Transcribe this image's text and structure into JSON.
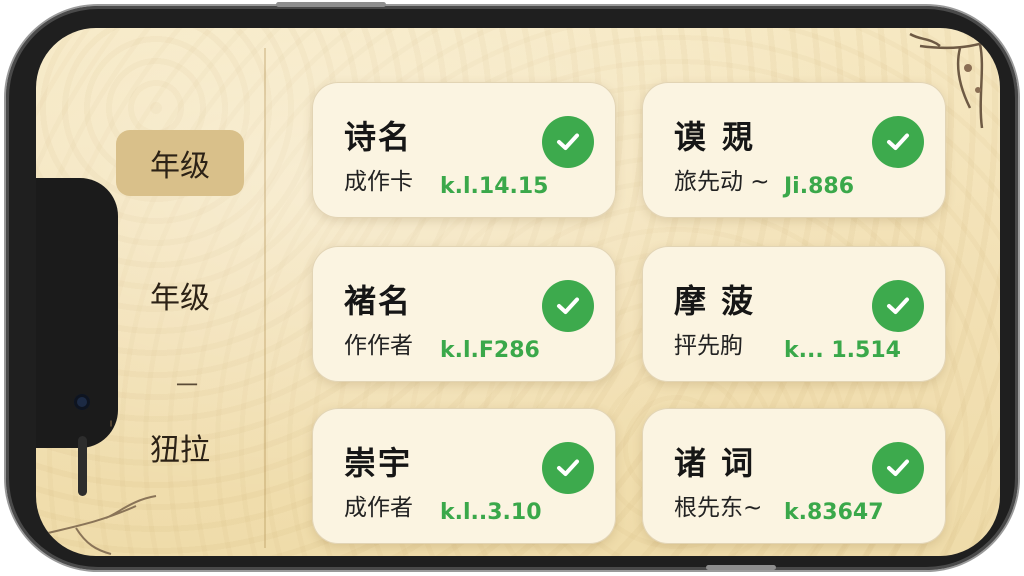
{
  "sidebar": {
    "items": [
      {
        "label": "年级",
        "active": true
      },
      {
        "label": "年级",
        "active": false
      },
      {
        "label": "狃拉",
        "active": false
      }
    ],
    "marks": [
      "一",
      "'"
    ]
  },
  "cards": [
    {
      "title": "诗名",
      "subtitle": "成作卡",
      "score": "k.l.14.15",
      "checked": true
    },
    {
      "title": "谟 覝",
      "subtitle": "旅先动 ~",
      "score": "Ji.886",
      "checked": true
    },
    {
      "title": "褚名",
      "subtitle": "作作者",
      "score": "k.l.F286",
      "checked": true
    },
    {
      "title": "摩 菠",
      "subtitle": "抨先朐",
      "score": "k... 1.514",
      "checked": true
    },
    {
      "title": "崇宇",
      "subtitle": "成作者",
      "score": "k.l..3.10",
      "checked": true
    },
    {
      "title": "诸 词",
      "subtitle": "根先东~",
      "score": "k.83647",
      "checked": true
    }
  ],
  "colors": {
    "background": "#f2e0b4",
    "card": "#fbf4e1",
    "active_tab": "#d9c08a",
    "check": "#3daa4d",
    "score_text": "#3aa84a"
  },
  "icons": [
    "checkmark-icon",
    "camera-icon",
    "branch-decoration"
  ]
}
